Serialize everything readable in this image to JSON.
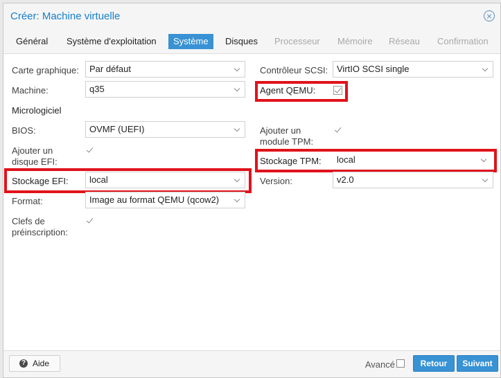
{
  "dialog": {
    "title": "Créer: Machine virtuelle"
  },
  "tabs": [
    {
      "label": "Général",
      "state": "normal"
    },
    {
      "label": "Système d'exploitation",
      "state": "normal"
    },
    {
      "label": "Système",
      "state": "active"
    },
    {
      "label": "Disques",
      "state": "normal"
    },
    {
      "label": "Processeur",
      "state": "disabled"
    },
    {
      "label": "Mémoire",
      "state": "disabled"
    },
    {
      "label": "Réseau",
      "state": "disabled"
    },
    {
      "label": "Confirmation",
      "state": "disabled"
    }
  ],
  "left": {
    "graphics": {
      "label": "Carte graphique:",
      "value": "Par défaut"
    },
    "machine": {
      "label": "Machine:",
      "value": "q35"
    },
    "firmware_section": "Micrologiciel",
    "bios": {
      "label": "BIOS:",
      "value": "OVMF (UEFI)"
    },
    "efi_disk": {
      "label_line1": "Ajouter un",
      "label_line2": "disque EFI:",
      "checked": true
    },
    "efi_storage": {
      "label": "Stockage EFI:",
      "value": "local"
    },
    "format": {
      "label": "Format:",
      "value": "Image au format QEMU (qcow2)"
    },
    "pre_enrolled_keys": {
      "label_line1": "Clefs de",
      "label_line2": "préinscription:",
      "checked": true
    }
  },
  "right": {
    "scsi_controller": {
      "label": "Contrôleur SCSI:",
      "value": "VirtIO SCSI single"
    },
    "qemu_agent": {
      "label": "Agent QEMU:",
      "checked": true
    },
    "tpm_module": {
      "label_line1": "Ajouter un",
      "label_line2": "module TPM:",
      "checked": true
    },
    "tpm_storage": {
      "label": "Stockage TPM:",
      "value": "local"
    },
    "version": {
      "label": "Version:",
      "value": "v2.0"
    }
  },
  "footer": {
    "help_label": "Aide",
    "advanced_label": "Avancé",
    "advanced_checked": false,
    "back_label": "Retour",
    "next_label": "Suivant"
  },
  "colors": {
    "accent": "#3892d4",
    "title": "#157fcc",
    "highlight": "#e0121b"
  }
}
